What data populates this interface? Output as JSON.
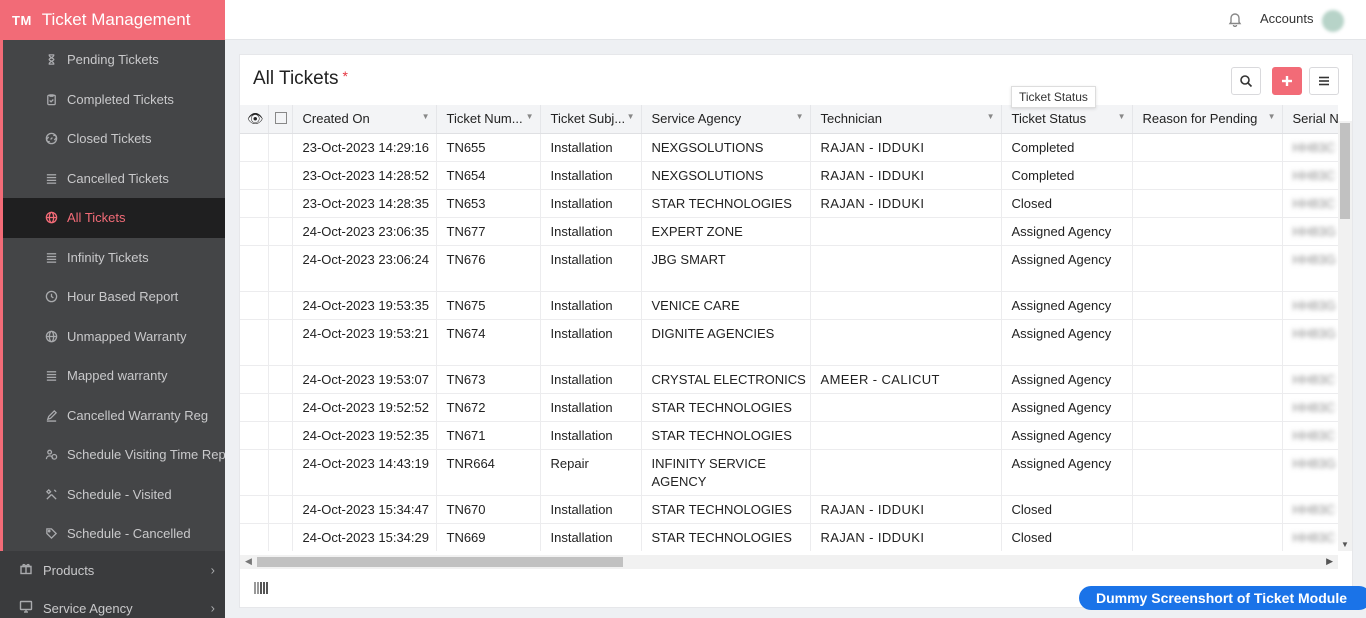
{
  "brand": {
    "logo": "TM",
    "title": "Ticket Management"
  },
  "sidebar": {
    "subitems": [
      {
        "label": "Pending Tickets",
        "icon": "hourglass-icon"
      },
      {
        "label": "Completed Tickets",
        "icon": "clipboard-check-icon"
      },
      {
        "label": "Closed Tickets",
        "icon": "link-icon"
      },
      {
        "label": "Cancelled Tickets",
        "icon": "list-icon"
      },
      {
        "label": "All Tickets",
        "icon": "globe-icon",
        "active": true
      },
      {
        "label": "Infinity Tickets",
        "icon": "list-icon"
      },
      {
        "label": "Hour Based Report",
        "icon": "clock-report-icon"
      },
      {
        "label": "Unmapped Warranty",
        "icon": "globe-icon"
      },
      {
        "label": "Mapped warranty",
        "icon": "list-icon"
      },
      {
        "label": "Cancelled Warranty Reg",
        "icon": "pencil-icon"
      },
      {
        "label": "Schedule Visiting Time Rep",
        "icon": "users-icon"
      },
      {
        "label": "Schedule - Visited",
        "icon": "tools-icon"
      },
      {
        "label": "Schedule - Cancelled",
        "icon": "tag-icon"
      }
    ],
    "main_items": [
      {
        "label": "Products",
        "icon": "gift-icon"
      },
      {
        "label": "Service Agency",
        "icon": "monitor-icon"
      }
    ],
    "active_color": "#f26b77"
  },
  "topbar": {
    "accounts": "Accounts"
  },
  "page": {
    "title": "All Tickets",
    "required_mark": "*",
    "tooltip": "Ticket Status"
  },
  "grid": {
    "columns": [
      "Created On",
      "Ticket Num...",
      "Ticket Subj...",
      "Service Agency",
      "Technician",
      "Ticket Status",
      "Reason for Pending",
      "Serial N"
    ],
    "rows": [
      {
        "created": "23-Oct-2023 14:29:16",
        "ticket": "TN655",
        "subject": "Installation",
        "agency": "NEXGSOLUTIONS",
        "tech": "RAJAN   - IDDUKI",
        "status": "Completed",
        "reason": "",
        "serial": "HH83C",
        "tall": false
      },
      {
        "created": "23-Oct-2023 14:28:52",
        "ticket": "TN654",
        "subject": "Installation",
        "agency": "NEXGSOLUTIONS",
        "tech": "RAJAN   - IDDUKI",
        "status": "Completed",
        "reason": "",
        "serial": "HH83C",
        "tall": false
      },
      {
        "created": "23-Oct-2023 14:28:35",
        "ticket": "TN653",
        "subject": "Installation",
        "agency": "STAR TECHNOLOGIES",
        "tech": "RAJAN   - IDDUKI",
        "status": "Closed",
        "reason": "",
        "serial": "HH83C",
        "tall": false
      },
      {
        "created": "24-Oct-2023 23:06:35",
        "ticket": "TN677",
        "subject": "Installation",
        "agency": "EXPERT ZONE",
        "tech": "",
        "status": "Assigned Agency",
        "reason": "",
        "serial": "HH83G",
        "tall": false
      },
      {
        "created": "24-Oct-2023 23:06:24",
        "ticket": "TN676",
        "subject": "Installation",
        "agency": "JBG SMART",
        "tech": "",
        "status": "Assigned Agency",
        "reason": "",
        "serial": "HH83G",
        "tall": true
      },
      {
        "created": "24-Oct-2023 19:53:35",
        "ticket": "TN675",
        "subject": "Installation",
        "agency": "VENICE CARE",
        "tech": "",
        "status": "Assigned Agency",
        "reason": "",
        "serial": "HH83G",
        "tall": false
      },
      {
        "created": "24-Oct-2023 19:53:21",
        "ticket": "TN674",
        "subject": "Installation",
        "agency": "DIGNITE AGENCIES",
        "tech": "",
        "status": "Assigned Agency",
        "reason": "",
        "serial": "HH83G",
        "tall": true
      },
      {
        "created": "24-Oct-2023 19:53:07",
        "ticket": "TN673",
        "subject": "Installation",
        "agency": "CRYSTAL ELECTRONICS",
        "tech": "AMEER - CALICUT",
        "status": "Assigned Agency",
        "reason": "",
        "serial": "HH83C",
        "tall": false
      },
      {
        "created": "24-Oct-2023 19:52:52",
        "ticket": "TN672",
        "subject": "Installation",
        "agency": "STAR TECHNOLOGIES",
        "tech": "",
        "status": "Assigned Agency",
        "reason": "",
        "serial": "HH83C",
        "tall": false
      },
      {
        "created": "24-Oct-2023 19:52:35",
        "ticket": "TN671",
        "subject": "Installation",
        "agency": "STAR TECHNOLOGIES",
        "tech": "",
        "status": "Assigned Agency",
        "reason": "",
        "serial": "HH83C",
        "tall": false
      },
      {
        "created": "24-Oct-2023 14:43:19",
        "ticket": "TNR664",
        "subject": "Repair",
        "agency": "INFINITY SERVICE AGENCY",
        "tech": "",
        "status": "Assigned Agency",
        "reason": "",
        "serial": "HH83G",
        "tall": true
      },
      {
        "created": "24-Oct-2023 15:34:47",
        "ticket": "TN670",
        "subject": "Installation",
        "agency": "STAR TECHNOLOGIES",
        "tech": "RAJAN   - IDDUKI",
        "status": "Closed",
        "reason": "",
        "serial": "HH83C",
        "tall": false
      },
      {
        "created": "24-Oct-2023 15:34:29",
        "ticket": "TN669",
        "subject": "Installation",
        "agency": "STAR TECHNOLOGIES",
        "tech": "RAJAN   - IDDUKI",
        "status": "Closed",
        "reason": "",
        "serial": "HH83C",
        "tall": false
      }
    ]
  },
  "banner": "Dummy Screenshort of Ticket Module"
}
